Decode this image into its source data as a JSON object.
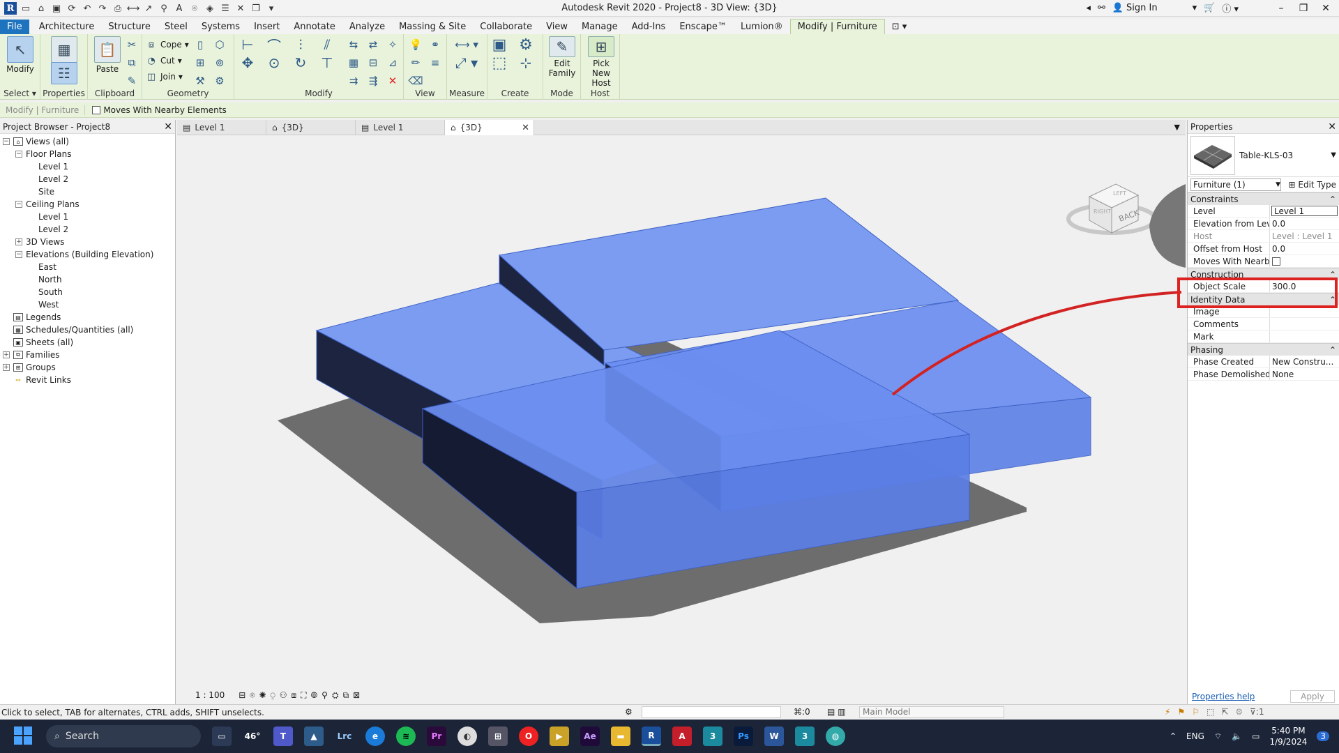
{
  "window": {
    "title": "Autodesk Revit 2020 - Project8 - 3D View: {3D}",
    "sign_in": "Sign In"
  },
  "ribbon_tabs": [
    "File",
    "Architecture",
    "Structure",
    "Steel",
    "Systems",
    "Insert",
    "Annotate",
    "Analyze",
    "Massing & Site",
    "Collaborate",
    "View",
    "Manage",
    "Add-Ins",
    "Enscape™",
    "Lumion®",
    "Modify | Furniture"
  ],
  "ribbon": {
    "modify": "Modify",
    "select": "Select",
    "properties": "Properties",
    "paste": "Paste",
    "clipboard": "Clipboard",
    "cope": "Cope",
    "cut": "Cut",
    "join": "Join",
    "geometry": "Geometry",
    "modify_group": "Modify",
    "view": "View",
    "measure": "Measure",
    "create": "Create",
    "edit_family_1": "Edit",
    "edit_family_2": "Family",
    "mode": "Mode",
    "pick_host_1": "Pick",
    "pick_host_2": "New Host",
    "host": "Host"
  },
  "options_bar": {
    "context": "Modify | Furniture",
    "moves_with": "Moves With Nearby Elements"
  },
  "browser": {
    "title": "Project Browser - Project8",
    "nodes": [
      {
        "label": "Views (all)",
        "level": 0,
        "toggle": "−",
        "icon": "views"
      },
      {
        "label": "Floor Plans",
        "level": 1,
        "toggle": "−"
      },
      {
        "label": "Level 1",
        "level": 2
      },
      {
        "label": "Level 2",
        "level": 2
      },
      {
        "label": "Site",
        "level": 2
      },
      {
        "label": "Ceiling Plans",
        "level": 1,
        "toggle": "−"
      },
      {
        "label": "Level 1",
        "level": 2
      },
      {
        "label": "Level 2",
        "level": 2
      },
      {
        "label": "3D Views",
        "level": 1,
        "toggle": "+"
      },
      {
        "label": "Elevations (Building Elevation)",
        "level": 1,
        "toggle": "−"
      },
      {
        "label": "East",
        "level": 2
      },
      {
        "label": "North",
        "level": 2
      },
      {
        "label": "South",
        "level": 2
      },
      {
        "label": "West",
        "level": 2
      },
      {
        "label": "Legends",
        "level": 0,
        "icon": "legend"
      },
      {
        "label": "Schedules/Quantities (all)",
        "level": 0,
        "icon": "schedule"
      },
      {
        "label": "Sheets (all)",
        "level": 0,
        "icon": "sheet"
      },
      {
        "label": "Families",
        "level": 0,
        "toggle": "+",
        "icon": "family"
      },
      {
        "label": "Groups",
        "level": 0,
        "toggle": "+",
        "icon": "group"
      },
      {
        "label": "Revit Links",
        "level": 0,
        "icon": "link"
      }
    ]
  },
  "view_tabs": [
    {
      "label": "Level 1",
      "icon": "plan"
    },
    {
      "label": "{3D}",
      "icon": "3d"
    },
    {
      "label": "Level 1",
      "icon": "plan"
    },
    {
      "label": "{3D}",
      "icon": "3d",
      "active": true
    }
  ],
  "viewcube": {
    "face": "BACK",
    "side": "RIGHT",
    "top": "LEFT"
  },
  "view_control": {
    "scale": "1 : 100"
  },
  "properties": {
    "title": "Properties",
    "type_name": "Table-KLS-03",
    "instance": "Furniture (1)",
    "edit_type": "Edit Type",
    "categories": [
      {
        "name": "Constraints",
        "rows": [
          {
            "name": "Level",
            "value": "Level 1",
            "edit": true
          },
          {
            "name": "Elevation from Level",
            "value": "0.0"
          },
          {
            "name": "Host",
            "value": "Level : Level 1",
            "grey": true
          },
          {
            "name": "Offset from Host",
            "value": "0.0"
          },
          {
            "name": "Moves With Nearb...",
            "value": "",
            "checkbox": true
          }
        ]
      },
      {
        "name": "Construction",
        "rows": [
          {
            "name": "Object Scale",
            "value": "300.0"
          }
        ]
      },
      {
        "name": "Identity Data",
        "rows": [
          {
            "name": "Image",
            "value": ""
          },
          {
            "name": "Comments",
            "value": ""
          },
          {
            "name": "Mark",
            "value": ""
          }
        ]
      },
      {
        "name": "Phasing",
        "rows": [
          {
            "name": "Phase Created",
            "value": "New Constru..."
          },
          {
            "name": "Phase Demolished",
            "value": "None"
          }
        ]
      }
    ],
    "help": "Properties help",
    "apply": "Apply"
  },
  "status": {
    "hint": "Click to select, TAB for alternates, CTRL adds, SHIFT unselects.",
    "zeros": ":0",
    "model": "Main Model",
    "filter": "1"
  },
  "taskbar": {
    "search": "Search",
    "weather": "46°",
    "lang": "ENG",
    "time": "5:40 PM",
    "date": "1/9/2024",
    "notif": "3"
  },
  "colors": {
    "ribbon_bg": "#e9f3dc",
    "accent_blue": "#1e73be",
    "highlight_red": "#d22222",
    "box_blue": "#5e82e6"
  }
}
